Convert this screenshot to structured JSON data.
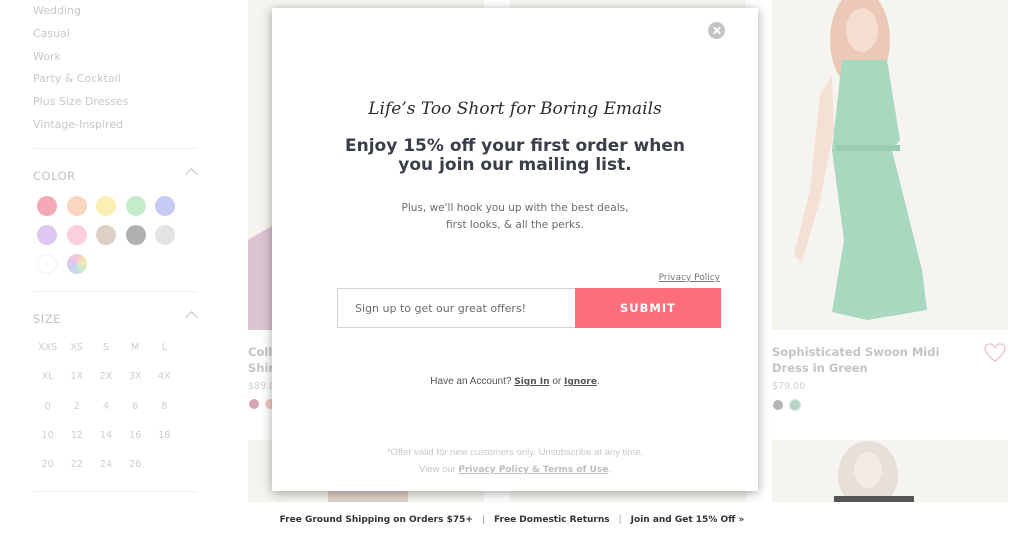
{
  "sidebar": {
    "categories": [
      "Wedding",
      "Casual",
      "Work",
      "Party & Cocktail",
      "Plus Size Dresses",
      "Vintage-Inspired"
    ],
    "color_section": {
      "title": "COLOR",
      "swatches": [
        {
          "name": "red",
          "hex": "#f5a9b6"
        },
        {
          "name": "orange",
          "hex": "#f9d6bd"
        },
        {
          "name": "yellow",
          "hex": "#fcf1b4"
        },
        {
          "name": "green",
          "hex": "#c4ebcb"
        },
        {
          "name": "blue",
          "hex": "#c6cbf5"
        },
        {
          "name": "purple",
          "hex": "#dec8f2"
        },
        {
          "name": "pink",
          "hex": "#fbd0dc"
        },
        {
          "name": "neutral",
          "hex": "#ddd0c5"
        },
        {
          "name": "grey",
          "hex": "#b0b0b0"
        },
        {
          "name": "silver",
          "hex": "#e3e3e3"
        },
        {
          "name": "white",
          "hex": "#ffffff"
        },
        {
          "name": "multi",
          "hex": "multi"
        }
      ]
    },
    "size_section": {
      "title": "SIZE",
      "sizes": [
        "XXS",
        "XS",
        "S",
        "M",
        "L",
        "XL",
        "1X",
        "2X",
        "3X",
        "4X",
        "0",
        "2",
        "4",
        "6",
        "8",
        "10",
        "12",
        "14",
        "16",
        "18",
        "20",
        "22",
        "24",
        "26"
      ]
    }
  },
  "products": [
    {
      "title_partial": "Coll\nShir",
      "price_partial": "$89.0",
      "swatches": [
        "#d9a3b4",
        "#f3c9c2"
      ]
    },
    {
      "title": "Sophisticated Swoon Midi Dress in Green",
      "price": "$79.00",
      "swatches": [
        "#b5b5b5",
        "#b7d6c8"
      ]
    }
  ],
  "promo_bar": {
    "items": [
      "Free Ground Shipping on Orders $75+",
      "Free Domestic Returns",
      "Join and Get 15% Off »"
    ],
    "separator": "|"
  },
  "modal": {
    "kicker": "Life’s Too Short for Boring Emails",
    "headline": "Enjoy 15% off your first order when you join our mailing list.",
    "sub_line1": "Plus, we'll hook you up with the best deals,",
    "sub_line2": "first looks, & all the perks.",
    "privacy_link": "Privacy Policy",
    "email_placeholder": "Sign up to get our great offers!",
    "email_value": "",
    "submit_label": "SUBMIT",
    "account_prefix": "Have an Account? ",
    "sign_in": "Sign In",
    "or": " or ",
    "ignore": "Ignore",
    "period": ".",
    "fine_line1": "*Offer valid for new customers only. Unsubscribe at any time.",
    "fine_prefix": "View our ",
    "fine_link": "Privacy Policy & Terms of Use",
    "fine_suffix": "."
  },
  "colors": {
    "submit_bg": "#fe6e7b",
    "headline_text": "#3a3e48"
  }
}
